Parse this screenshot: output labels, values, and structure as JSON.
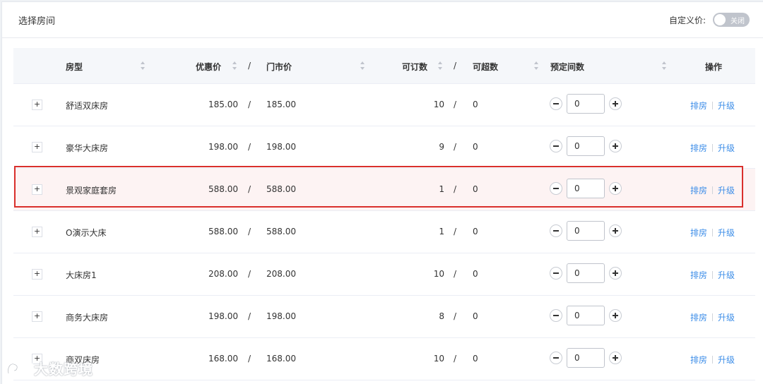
{
  "panel": {
    "title": "选择房间",
    "custom_price_label": "自定义价:",
    "toggle_text": "关闭"
  },
  "table": {
    "headers": {
      "room_type": "房型",
      "discount_price": "优惠价",
      "rack_price": "门市价",
      "bookable": "可订数",
      "overbook": "可超数",
      "reserve_count": "预定间数",
      "operation": "操作"
    },
    "slash": "/",
    "rows": [
      {
        "name": "舒适双床房",
        "discount": "185.00",
        "rack": "185.00",
        "bookable": "10",
        "overbook": "0",
        "count": "0"
      },
      {
        "name": "豪华大床房",
        "discount": "198.00",
        "rack": "198.00",
        "bookable": "9",
        "overbook": "0",
        "count": "0"
      },
      {
        "name": "景观家庭套房",
        "discount": "588.00",
        "rack": "588.00",
        "bookable": "1",
        "overbook": "0",
        "count": "0"
      },
      {
        "name": "O演示大床",
        "discount": "588.00",
        "rack": "588.00",
        "bookable": "1",
        "overbook": "0",
        "count": "0"
      },
      {
        "name": "大床房1",
        "discount": "208.00",
        "rack": "208.00",
        "bookable": "10",
        "overbook": "0",
        "count": "0"
      },
      {
        "name": "商务大床房",
        "discount": "198.00",
        "rack": "198.00",
        "bookable": "8",
        "overbook": "0",
        "count": "0"
      },
      {
        "name": "商双床房",
        "discount": "168.00",
        "rack": "168.00",
        "bookable": "10",
        "overbook": "0",
        "count": "0"
      }
    ],
    "expand_symbol": "+",
    "action_assign": "排房",
    "action_upgrade": "升级"
  },
  "watermark": "大数跨境",
  "colors": {
    "link": "#3d8ee8",
    "highlight_border": "#d9302c",
    "highlight_bg": "#fdf3f3"
  }
}
